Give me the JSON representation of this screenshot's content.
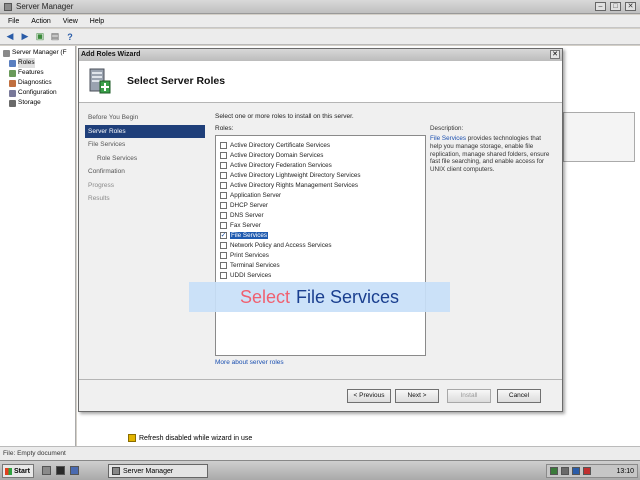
{
  "server_manager": {
    "title": "Server Manager",
    "menu": [
      "File",
      "Action",
      "View",
      "Help"
    ],
    "tree": [
      {
        "label": "Server Manager (F",
        "level": 0
      },
      {
        "label": "Roles",
        "level": 1
      },
      {
        "label": "Features",
        "level": 1
      },
      {
        "label": "Diagnostics",
        "level": 1
      },
      {
        "label": "Configuration",
        "level": 1
      },
      {
        "label": "Storage",
        "level": 1
      }
    ],
    "status_text": "File: Empty document",
    "refresh_note": "Refresh disabled while wizard in use"
  },
  "wizard": {
    "title": "Add Roles Wizard",
    "header_title": "Select Server Roles",
    "nav": [
      {
        "label": "Before You Begin",
        "state": "normal",
        "indent": false
      },
      {
        "label": "Server Roles",
        "state": "active",
        "indent": false
      },
      {
        "label": "File Services",
        "state": "normal",
        "indent": false
      },
      {
        "label": "Role Services",
        "state": "normal",
        "indent": true
      },
      {
        "label": "Confirmation",
        "state": "normal",
        "indent": false
      },
      {
        "label": "Progress",
        "state": "muted",
        "indent": false
      },
      {
        "label": "Results",
        "state": "muted",
        "indent": false
      }
    ],
    "instruction": "Select one or more roles to install on this server.",
    "roles_label": "Roles:",
    "roles": [
      {
        "label": "Active Directory Certificate Services",
        "checked": false
      },
      {
        "label": "Active Directory Domain Services",
        "checked": false
      },
      {
        "label": "Active Directory Federation Services",
        "checked": false
      },
      {
        "label": "Active Directory Lightweight Directory Services",
        "checked": false
      },
      {
        "label": "Active Directory Rights Management Services",
        "checked": false
      },
      {
        "label": "Application Server",
        "checked": false
      },
      {
        "label": "DHCP Server",
        "checked": false
      },
      {
        "label": "DNS Server",
        "checked": false
      },
      {
        "label": "Fax Server",
        "checked": false
      },
      {
        "label": "File Services",
        "checked": true,
        "selected": true
      },
      {
        "label": "Network Policy and Access Services",
        "checked": false
      },
      {
        "label": "Print Services",
        "checked": false
      },
      {
        "label": "Terminal Services",
        "checked": false
      },
      {
        "label": "UDDI Services",
        "checked": false
      }
    ],
    "description_title": "Description:",
    "description_link": "File Services",
    "description_text": " provides technologies that help you manage storage, enable file replication, manage shared folders, ensure fast file searching, and enable access for UNIX client computers.",
    "more_link": "More about server roles",
    "buttons": {
      "previous": "< Previous",
      "next": "Next >",
      "install": "Install",
      "cancel": "Cancel"
    }
  },
  "caption": {
    "part1": "Select",
    "part2": "File Services"
  },
  "taskbar": {
    "start": "Start",
    "task": "Server Manager",
    "clock": "13:10"
  }
}
